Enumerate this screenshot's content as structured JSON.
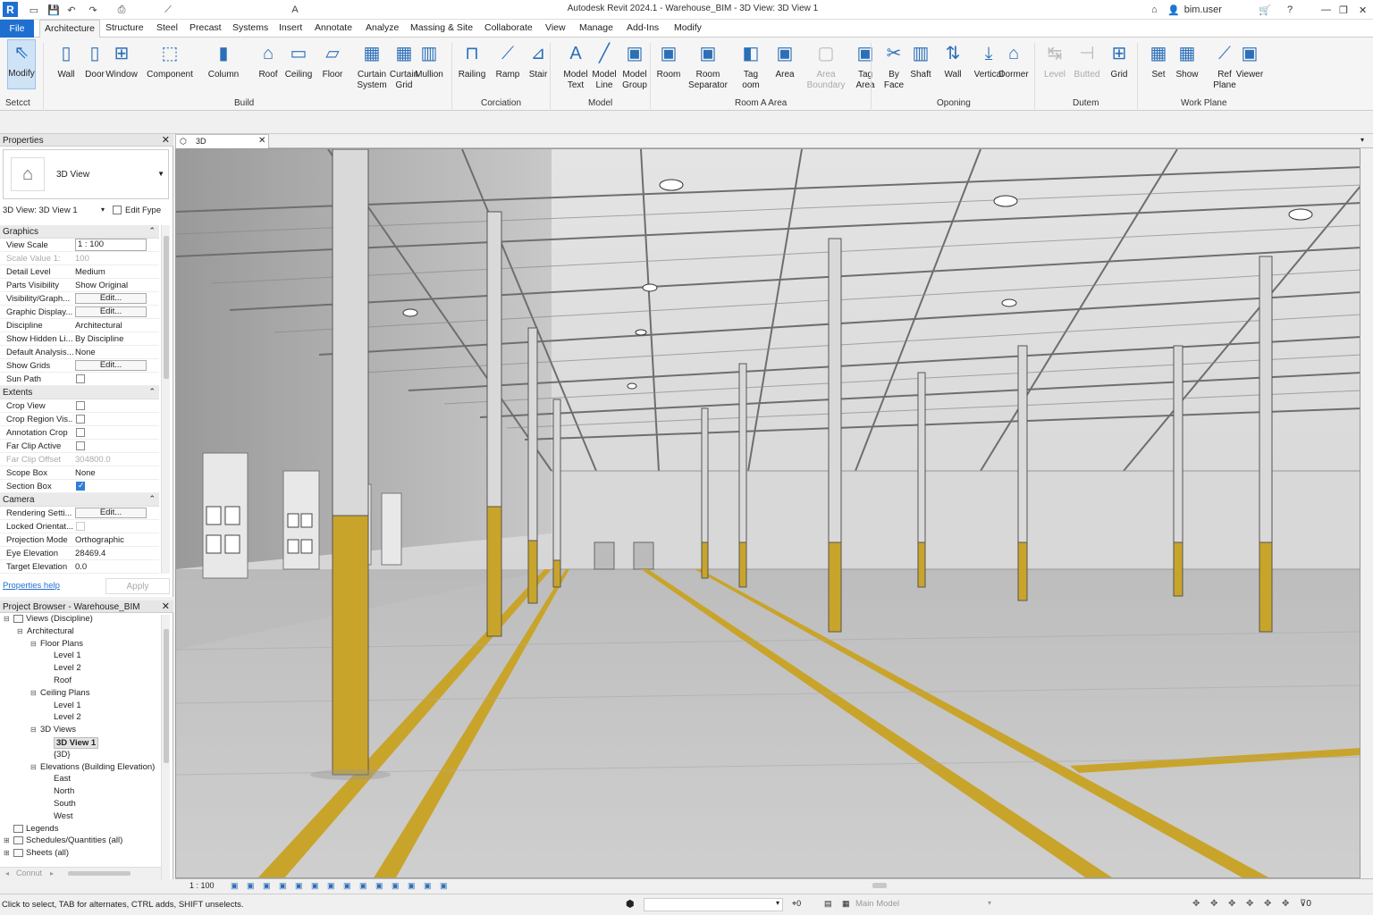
{
  "app": {
    "title": "Autodesk Revit 2024.1 - Warehouse_BIM - 3D View: 3D View 1",
    "logo": "R",
    "user": "bim.user"
  },
  "quick_access": [
    "open-icon",
    "save-icon",
    "undo-icon",
    "redo-icon",
    "print-icon",
    "measure-icon",
    "text-icon"
  ],
  "menu_tabs": [
    "File",
    "Architecture",
    "Structure",
    "Steel",
    "Precast",
    "Systems",
    "Insert",
    "Annotate",
    "Analyze",
    "Massing & Site",
    "Collaborate",
    "View",
    "Manage",
    "Add-Ins",
    "Modify"
  ],
  "ribbon": {
    "buttons": [
      {
        "label": "Modify",
        "icon": "cursor-icon"
      },
      {
        "label": "Wall",
        "icon": "wall-icon"
      },
      {
        "label": "Door",
        "icon": "door-icon"
      },
      {
        "label": "Window",
        "icon": "window-icon"
      },
      {
        "label": "Component",
        "icon": "component-icon"
      },
      {
        "label": "Column",
        "icon": "column-icon"
      },
      {
        "label": "Roof",
        "icon": "roof-icon"
      },
      {
        "label": "Ceiling",
        "icon": "ceiling-icon"
      },
      {
        "label": "Floor",
        "icon": "floor-icon"
      },
      {
        "label": "Curtain\nSystem",
        "icon": "curtain-system-icon"
      },
      {
        "label": "Curtain\nGrid",
        "icon": "curtain-grid-icon"
      },
      {
        "label": "Mullion",
        "icon": "mullion-icon"
      },
      {
        "label": "Railing",
        "icon": "railing-icon"
      },
      {
        "label": "Ramp",
        "icon": "ramp-icon"
      },
      {
        "label": "Stair",
        "icon": "stair-icon"
      },
      {
        "label": "Model\nText",
        "icon": "model-text-icon"
      },
      {
        "label": "Model\nLine",
        "icon": "model-line-icon"
      },
      {
        "label": "Model\nGroup",
        "icon": "model-group-icon"
      },
      {
        "label": "Room",
        "icon": "room-icon"
      },
      {
        "label": "Room\nSeparator",
        "icon": "room-separator-icon"
      },
      {
        "label": "Tag\noom",
        "icon": "tag-room-icon"
      },
      {
        "label": "Area",
        "icon": "area-icon"
      },
      {
        "label": "Area\nBoundary",
        "icon": "area-boundary-icon"
      },
      {
        "label": "Tag\nArea",
        "icon": "tag-area-icon"
      },
      {
        "label": "By\nFace",
        "icon": "by-face-icon"
      },
      {
        "label": "Shaft",
        "icon": "shaft-icon"
      },
      {
        "label": "Wall",
        "icon": "wall-opening-icon"
      },
      {
        "label": "Vertical",
        "icon": "vertical-icon"
      },
      {
        "label": "Dormer",
        "icon": "dormer-icon"
      },
      {
        "label": "Level",
        "icon": "level-icon"
      },
      {
        "label": "Butted",
        "icon": "butted-icon"
      },
      {
        "label": "Grid",
        "icon": "grid-icon"
      },
      {
        "label": "Set",
        "icon": "set-icon"
      },
      {
        "label": "Show",
        "icon": "show-icon"
      },
      {
        "label": "Ref\nPlane",
        "icon": "ref-plane-icon"
      },
      {
        "label": "Viewer",
        "icon": "viewer-icon"
      }
    ],
    "groups": [
      "Setcct",
      "Build",
      "Corciation",
      "Model",
      "Room A Area",
      "Oponing",
      "Dutem",
      "Work Plane"
    ]
  },
  "properties": {
    "title": "Properties",
    "type": "3D View",
    "selector": "3D View: 3D View 1",
    "edit_type": "Edit Fype",
    "categories": [
      "Graphics",
      "Extents",
      "Camera"
    ],
    "rows": [
      {
        "k": "View Scale",
        "v": "1 : 100",
        "kind": "input"
      },
      {
        "k": "Scale Value  1:",
        "v": "100",
        "kind": "dim"
      },
      {
        "k": "Detail Level",
        "v": "Medium"
      },
      {
        "k": "Parts Visibility",
        "v": "Show Original"
      },
      {
        "k": "Visibility/Graph...",
        "v": "Edit...",
        "kind": "btn"
      },
      {
        "k": "Graphic Display...",
        "v": "Edit...",
        "kind": "btn"
      },
      {
        "k": "Discipline",
        "v": "Architectural"
      },
      {
        "k": "Show Hidden Li...",
        "v": "By Discipline"
      },
      {
        "k": "Default Analysis...",
        "v": "None"
      },
      {
        "k": "Show Grids",
        "v": "Edit...",
        "kind": "btn"
      },
      {
        "k": "Sun Path",
        "v": "",
        "kind": "cb"
      },
      {
        "k": "Crop View",
        "v": "",
        "kind": "cb"
      },
      {
        "k": "Crop Region Vis...",
        "v": "",
        "kind": "cb"
      },
      {
        "k": "Annotation Crop",
        "v": "",
        "kind": "cb"
      },
      {
        "k": "Far Clip Active",
        "v": "",
        "kind": "cb"
      },
      {
        "k": "Far Clip Offset",
        "v": "304800.0",
        "kind": "dim"
      },
      {
        "k": "Scope Box",
        "v": "None"
      },
      {
        "k": "Section Box",
        "v": "",
        "kind": "cbon"
      },
      {
        "k": "Rendering Setti...",
        "v": "Edit...",
        "kind": "btn"
      },
      {
        "k": "Locked Orientat...",
        "v": "",
        "kind": "cbdim"
      },
      {
        "k": "Projection Mode",
        "v": "Orthographic"
      },
      {
        "k": "Eye Elevation",
        "v": "28469.4"
      },
      {
        "k": "Target Elevation",
        "v": "0.0"
      }
    ],
    "help": "Properties help",
    "apply": "Apply"
  },
  "browser": {
    "title": "Project Browser - Warehouse_BIM",
    "nodes": [
      {
        "t": "Views (Discipline)",
        "lvl": 0,
        "tg": "⊟"
      },
      {
        "t": "Architectural",
        "lvl": 1,
        "tg": "⊟"
      },
      {
        "t": "Floor Plans",
        "lvl": 2,
        "tg": "⊟"
      },
      {
        "t": "Level 1",
        "lvl": 3
      },
      {
        "t": "Level 2",
        "lvl": 3
      },
      {
        "t": "Roof",
        "lvl": 3
      },
      {
        "t": "Ceiling Plans",
        "lvl": 2,
        "tg": "⊟"
      },
      {
        "t": "Level 1",
        "lvl": 3
      },
      {
        "t": "Level 2",
        "lvl": 3
      },
      {
        "t": "3D Views",
        "lvl": 2,
        "tg": "⊟"
      },
      {
        "t": "3D View 1",
        "lvl": 3,
        "sel": true
      },
      {
        "t": "{3D}",
        "lvl": 3
      },
      {
        "t": "Elevations (Building Elevation)",
        "lvl": 2,
        "tg": "⊟"
      },
      {
        "t": "East",
        "lvl": 3
      },
      {
        "t": "North",
        "lvl": 3
      },
      {
        "t": "South",
        "lvl": 3
      },
      {
        "t": "West",
        "lvl": 3
      },
      {
        "t": "Legends",
        "lvl": 0,
        "icon": true
      },
      {
        "t": "Schedules/Quantities (all)",
        "lvl": 0,
        "icon": true,
        "tg": "⊞"
      },
      {
        "t": "Sheets (all)",
        "lvl": 0,
        "icon": true,
        "tg": "⊞"
      }
    ],
    "scroll_label": "Connut"
  },
  "view_tab": {
    "label": "3D"
  },
  "view_bar": {
    "scale": "1 : 100"
  },
  "status": {
    "hint": "Click to select, TAB for alternates, CTRL adds, SHIFT unselects.",
    "model": "Main Model",
    "count_left": "0",
    "count_right": "0"
  },
  "colors": {
    "accent": "#1f6fd1",
    "column_base": "#c9a42b"
  }
}
